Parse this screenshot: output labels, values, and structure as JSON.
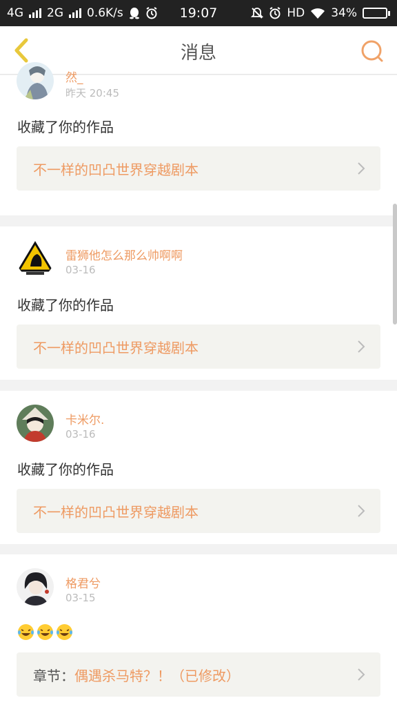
{
  "status_bar": {
    "net1": "4G",
    "net2": "2G",
    "speed": "0.6K/s",
    "time": "19:07",
    "hd": "HD",
    "battery": "34%",
    "battery_level": 0.34
  },
  "header": {
    "title": "消息"
  },
  "messages": [
    {
      "user": "然_",
      "time": "昨天 20:45",
      "text": "收藏了你的作品",
      "link": {
        "prefix": "",
        "title": "不一样的凹凸世界穿越剧本"
      }
    },
    {
      "user": "雷狮他怎么那么帅啊啊",
      "time": "03-16",
      "text": "收藏了你的作品",
      "link": {
        "prefix": "",
        "title": "不一样的凹凸世界穿越剧本"
      }
    },
    {
      "user": "卡米尔.",
      "time": "03-16",
      "text": "收藏了你的作品",
      "link": {
        "prefix": "",
        "title": "不一样的凹凸世界穿越剧本"
      }
    },
    {
      "user": "格君兮",
      "time": "03-15",
      "text": "",
      "emoji": [
        "laughing-tears",
        "laughing-tears",
        "laughing-tears"
      ],
      "link": {
        "prefix": "章节：",
        "title": "偶遇杀马特？！（已修改）"
      }
    }
  ],
  "colors": {
    "accent": "#ee9a62",
    "back_icon": "#e8c83c",
    "status_bg": "#222222"
  }
}
